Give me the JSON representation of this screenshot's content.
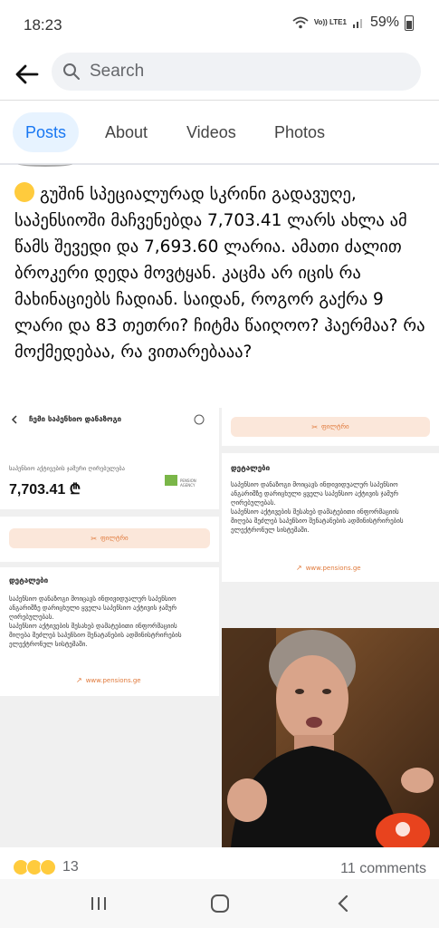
{
  "status": {
    "time": "18:23",
    "network": "Vo)) LTE1",
    "battery": "59%"
  },
  "search": {
    "placeholder": "Search"
  },
  "tabs": [
    {
      "label": "Posts"
    },
    {
      "label": "About"
    },
    {
      "label": "Videos"
    },
    {
      "label": "Photos"
    }
  ],
  "post": {
    "text": "გუშინ სპეციალურად სკრინი გადავუღე, საპენსიოში მაჩვენებდა 7,703.41 ლარს ახლა ამ წამს შევედი და 7,693.60 ლარია. ამათი ძალით ბროკერი დედა მოვტყან. კაცმა არ იცის რა მახინაციებს ჩადიან. საიდან, როგორ გაქრა 9 ლარი და 83 თეთრი? ჩიტმა წაიღოო? ჰაერმაა? რა მოქმედებაა, რა ვითარებააა?"
  },
  "collage": {
    "app_title": "ჩემი საპენსიო დანაზოგი",
    "asset_label": "საპენსიო აქტივების ჯამური ღირებულება",
    "amount": "7,703.41 ₾",
    "logo_text": "PENSION AGENCY",
    "filter_button": "ფილტრი",
    "details_title": "დეტალები",
    "details_text_1": "საპენსიო დანაზოგი მოიცავს ინდივიდუალურ საპენსიო ანგარიშზე დარიცხული ყველა საპენსიო აქტივის ჯამურ ღირებულებას.",
    "details_text_2": "საპენსიო აქტივების შესახებ დამატებითი ინფორმაციის მიღება შეძლებ საპენსიო შენატანების ადმინისტრირების ელექტრონულ სისტემაში.",
    "link": "www.pensions.ge"
  },
  "footer": {
    "reaction_count": "13",
    "comments": "11 comments"
  },
  "colors": {
    "accent": "#1877f2",
    "active_tab_bg": "#e7f3ff",
    "orange": "#e07a3c"
  }
}
